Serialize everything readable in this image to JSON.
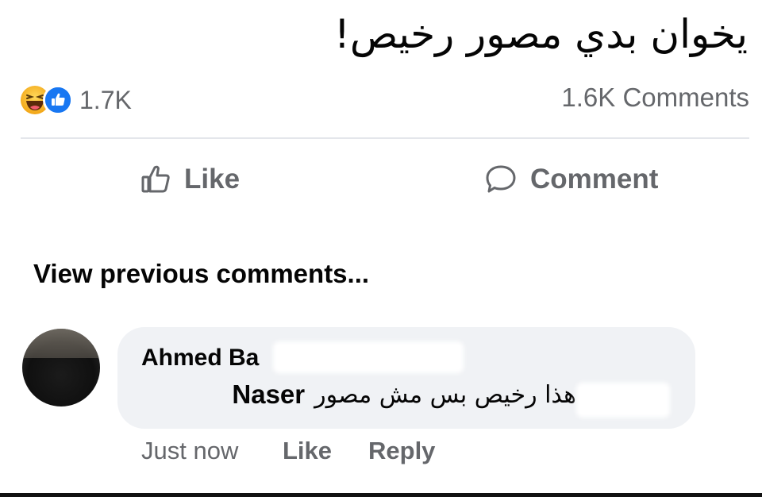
{
  "post": {
    "text": "يخوان بدي مصور رخيص!",
    "reaction_count": "1.7K",
    "comment_count": "1.6K Comments",
    "reactions": [
      "haha-icon",
      "like-icon"
    ]
  },
  "actions": {
    "like_label": "Like",
    "comment_label": "Comment"
  },
  "comments_section": {
    "view_previous": "View previous comments...",
    "comment": {
      "author": "Ahmed Ba",
      "mention": "Naser",
      "text": "هذا رخيص بس مش مصور",
      "time": "Just now",
      "like_label": "Like",
      "reply_label": "Reply"
    }
  },
  "colors": {
    "like_blue": "#1877f2",
    "haha_yellow": "#f7b125",
    "muted_text": "#65676b",
    "bubble_bg": "#f0f2f5"
  }
}
